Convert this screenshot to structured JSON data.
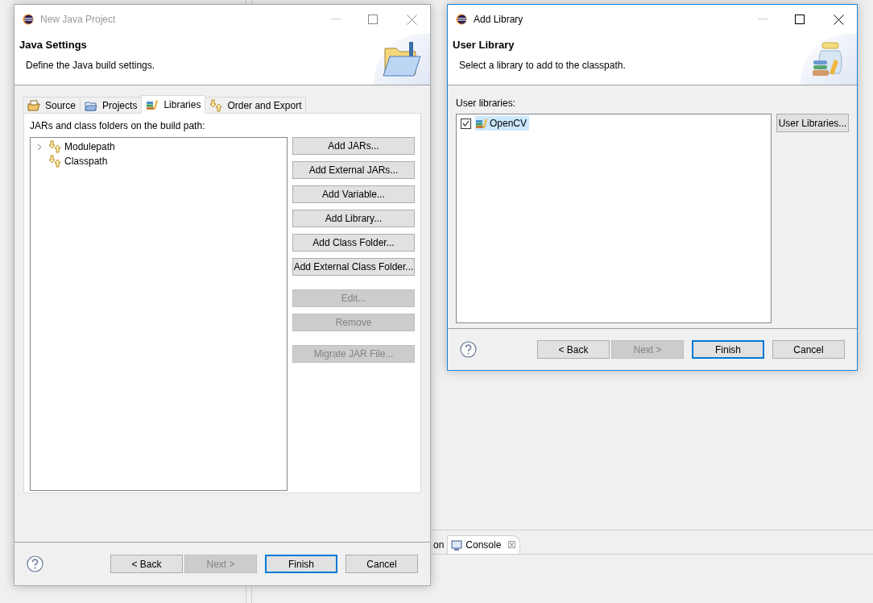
{
  "background": {
    "partial_tab": "on",
    "console_tab": {
      "label": "Console",
      "close": "☒"
    }
  },
  "project_dialog": {
    "title": "New Java Project",
    "active": false,
    "heading": "Java Settings",
    "description": "Define the Java build settings.",
    "tabs": [
      {
        "label": "Source",
        "kind": "source",
        "selected": false
      },
      {
        "label": "Projects",
        "kind": "projects",
        "selected": false
      },
      {
        "label": "Libraries",
        "kind": "libraries",
        "selected": true
      },
      {
        "label": "Order and Export",
        "kind": "order",
        "selected": false
      }
    ],
    "path_label": "JARs and class folders on the build path:",
    "tree": [
      {
        "label": "Modulepath",
        "expandable": true
      },
      {
        "label": "Classpath",
        "expandable": false
      }
    ],
    "button_groups": [
      [
        {
          "label": "Add JARs...",
          "disabled": false
        },
        {
          "label": "Add External JARs...",
          "disabled": false
        },
        {
          "label": "Add Variable...",
          "disabled": false
        },
        {
          "label": "Add Library...",
          "disabled": false
        },
        {
          "label": "Add Class Folder...",
          "disabled": false
        },
        {
          "label": "Add External Class Folder...",
          "disabled": false
        }
      ],
      [
        {
          "label": "Edit...",
          "disabled": true
        },
        {
          "label": "Remove",
          "disabled": true
        }
      ],
      [
        {
          "label": "Migrate JAR File...",
          "disabled": true
        }
      ]
    ],
    "footer_buttons": [
      {
        "label": "< Back",
        "disabled": false,
        "default": false
      },
      {
        "label": "Next >",
        "disabled": true,
        "default": false
      },
      {
        "label": "Finish",
        "disabled": false,
        "default": true
      },
      {
        "label": "Cancel",
        "disabled": false,
        "default": false
      }
    ]
  },
  "library_dialog": {
    "title": "Add Library",
    "active": true,
    "heading": "User Library",
    "description": "Select a library to add to the classpath.",
    "list_label": "User libraries:",
    "libraries": [
      {
        "label": "OpenCV",
        "checked": true,
        "selected": true
      }
    ],
    "side_button": "User Libraries...",
    "footer_buttons": [
      {
        "label": "< Back",
        "disabled": false,
        "default": false
      },
      {
        "label": "Next >",
        "disabled": true,
        "default": false
      },
      {
        "label": "Finish",
        "disabled": false,
        "default": true
      },
      {
        "label": "Cancel",
        "disabled": false,
        "default": false
      }
    ]
  }
}
